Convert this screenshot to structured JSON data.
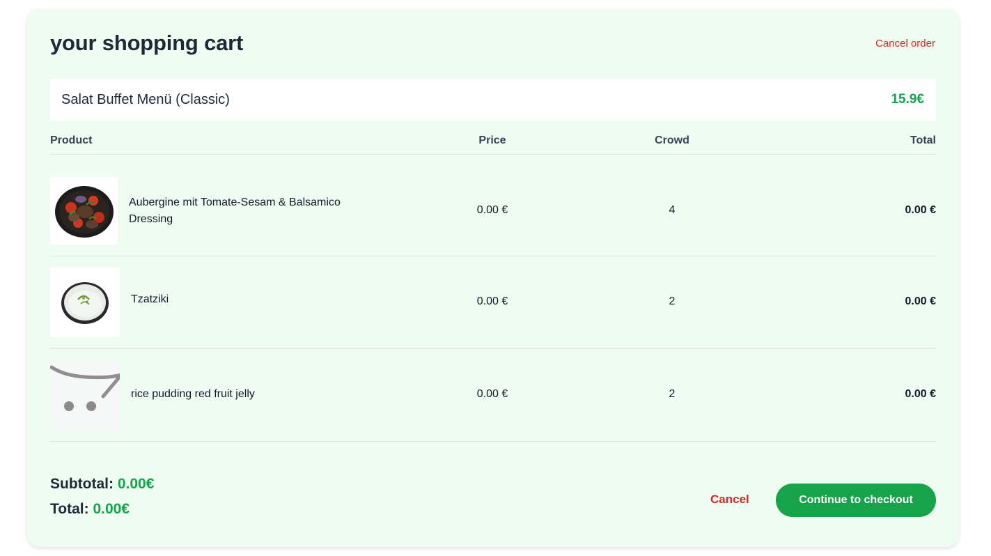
{
  "cart": {
    "title": "your shopping cart",
    "cancel_order_label": "Cancel order"
  },
  "menu": {
    "name": "Salat Buffet Menü (Classic)",
    "price": "15.9€"
  },
  "table": {
    "headers": {
      "product": "Product",
      "price": "Price",
      "crowd": "Crowd",
      "total": "Total"
    },
    "rows": [
      {
        "name": "Aubergine mit Tomate-Sesam & Balsamico Dressing",
        "price": "0.00 €",
        "qty": "4",
        "total": "0.00 €",
        "image": "eggplant-tomato-dish"
      },
      {
        "name": "Tzatziki",
        "price": "0.00 €",
        "qty": "2",
        "total": "0.00 €",
        "image": "tzatziki-bowl"
      },
      {
        "name": "rice pudding red fruit jelly",
        "price": "0.00 €",
        "qty": "2",
        "total": "0.00 €",
        "image": "cart-placeholder-icon"
      }
    ]
  },
  "summary": {
    "subtotal_label": "Subtotal:",
    "subtotal_value": "0.00€",
    "total_label": "Total:",
    "total_value": "0.00€"
  },
  "actions": {
    "cancel_label": "Cancel",
    "checkout_label": "Continue to checkout"
  },
  "colors": {
    "accent_green": "#16a34a",
    "danger_red": "#dc2626",
    "card_background": "#effcf2"
  }
}
